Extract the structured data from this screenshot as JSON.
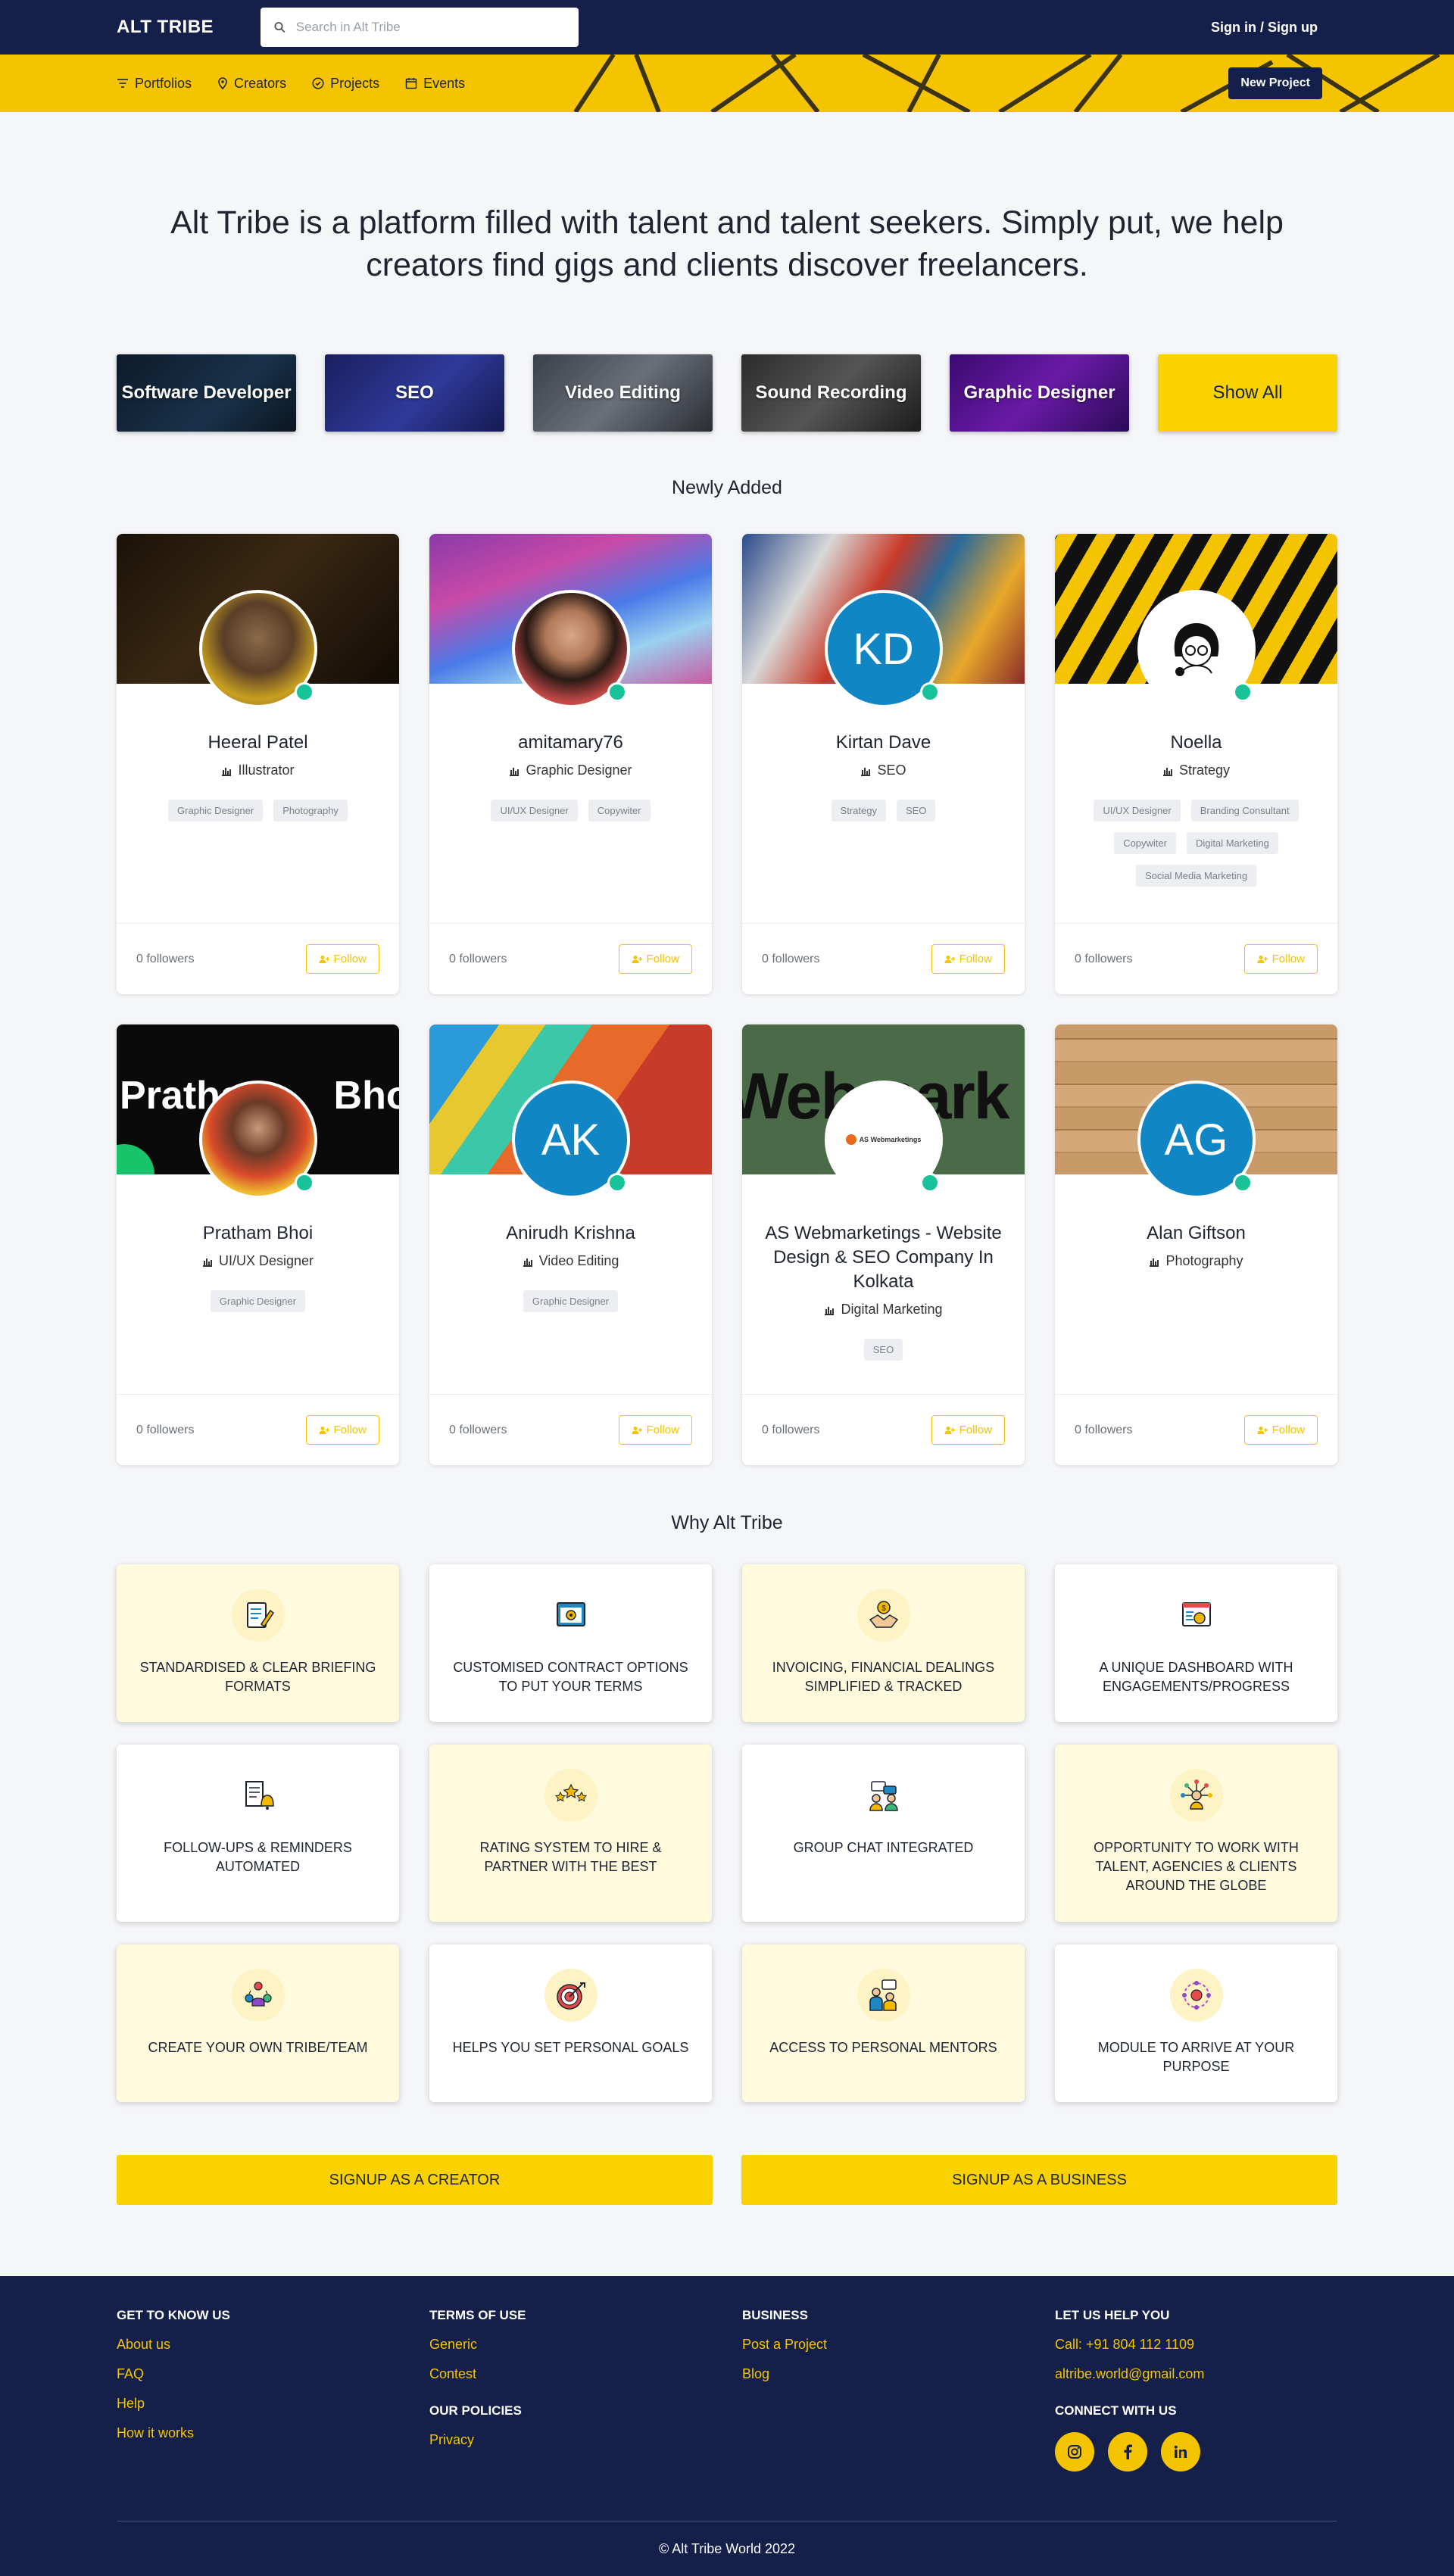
{
  "header": {
    "brand": "ALT TRIBE",
    "search_placeholder": "Search in Alt Tribe",
    "signin": "Sign in / Sign up"
  },
  "nav": {
    "items": [
      {
        "label": "Portfolios",
        "icon": "filter-icon"
      },
      {
        "label": "Creators",
        "icon": "location-pin-icon"
      },
      {
        "label": "Projects",
        "icon": "check-circle-icon"
      },
      {
        "label": "Events",
        "icon": "calendar-icon"
      }
    ],
    "new_project": "New Project"
  },
  "hero": {
    "text": "Alt Tribe is a platform filled with talent and talent seekers. Simply put, we help creators find gigs and clients discover freelancers."
  },
  "categories": [
    "Software Developer",
    "SEO",
    "Video Editing",
    "Sound Recording",
    "Graphic Designer",
    "Show All"
  ],
  "newly_added": {
    "title": "Newly Added",
    "cards": [
      {
        "name": "Heeral Patel",
        "role": "Illustrator",
        "tags": [
          "Graphic Designer",
          "Photography"
        ],
        "followers": "0 followers",
        "follow": "Follow",
        "initials": ""
      },
      {
        "name": "amitamary76",
        "role": "Graphic Designer",
        "tags": [
          "UI/UX Designer",
          "Copywiter"
        ],
        "followers": "0 followers",
        "follow": "Follow",
        "initials": ""
      },
      {
        "name": "Kirtan Dave",
        "role": "SEO",
        "tags": [
          "Strategy",
          "SEO"
        ],
        "followers": "0 followers",
        "follow": "Follow",
        "initials": "KD"
      },
      {
        "name": "Noella",
        "role": "Strategy",
        "tags": [
          "UI/UX Designer",
          "Branding Consultant",
          "Copywiter",
          "Digital Marketing",
          "Social Media Marketing"
        ],
        "followers": "0 followers",
        "follow": "Follow",
        "initials": ""
      },
      {
        "name": "Pratham Bhoi",
        "role": "UI/UX Designer",
        "tags": [
          "Graphic Designer"
        ],
        "followers": "0 followers",
        "follow": "Follow",
        "initials": "",
        "cover_text": "Pratham Bhoi"
      },
      {
        "name": "Anirudh Krishna",
        "role": "Video Editing",
        "tags": [
          "Graphic Designer"
        ],
        "followers": "0 followers",
        "follow": "Follow",
        "initials": "AK"
      },
      {
        "name": "AS Webmarketings - Website Design & SEO Company In Kolkata",
        "role": "Digital Marketing",
        "tags": [
          "SEO"
        ],
        "followers": "0 followers",
        "follow": "Follow",
        "initials": "",
        "cover_text": "Webmark",
        "logo_text": "AS Webmarketings"
      },
      {
        "name": "Alan Giftson",
        "role": "Photography",
        "tags": [],
        "followers": "0 followers",
        "follow": "Follow",
        "initials": "AG"
      }
    ]
  },
  "why": {
    "title": "Why Alt Tribe",
    "items": [
      {
        "text": "STANDARDISED & CLEAR BRIEFING FORMATS",
        "icon": "briefing-icon"
      },
      {
        "text": "CUSTOMISED CONTRACT OPTIONS TO PUT YOUR TERMS",
        "icon": "contract-icon"
      },
      {
        "text": "INVOICING, FINANCIAL DEALINGS SIMPLIFIED & TRACKED",
        "icon": "invoice-handshake-icon"
      },
      {
        "text": "A UNIQUE DASHBOARD WITH ENGAGEMENTS/PROGRESS",
        "icon": "dashboard-icon"
      },
      {
        "text": "FOLLOW-UPS & REMINDERS AUTOMATED",
        "icon": "reminder-bell-icon"
      },
      {
        "text": "RATING SYSTEM TO HIRE & PARTNER WITH THE BEST",
        "icon": "rating-stars-icon"
      },
      {
        "text": "GROUP CHAT INTEGRATED",
        "icon": "group-chat-icon"
      },
      {
        "text": "OPPORTUNITY TO WORK WITH TALENT, AGENCIES & CLIENTS AROUND THE GLOBE",
        "icon": "network-icon"
      },
      {
        "text": "CREATE YOUR OWN TRIBE/TEAM",
        "icon": "team-icon"
      },
      {
        "text": "HELPS YOU SET PERSONAL GOALS",
        "icon": "target-icon"
      },
      {
        "text": "ACCESS TO PERSONAL MENTORS",
        "icon": "mentor-icon"
      },
      {
        "text": "MODULE TO ARRIVE AT YOUR PURPOSE",
        "icon": "purpose-icon"
      }
    ]
  },
  "signup": {
    "creator": "SIGNUP AS A CREATOR",
    "business": "SIGNUP AS A BUSINESS"
  },
  "footer": {
    "col1": {
      "title": "GET TO KNOW US",
      "links": [
        "About us",
        "FAQ",
        "Help",
        "How it works"
      ]
    },
    "col2": {
      "title": "TERMS OF USE",
      "links": [
        "Generic",
        "Contest"
      ],
      "title2": "OUR POLICIES",
      "links2": [
        "Privacy"
      ]
    },
    "col3": {
      "title": "BUSINESS",
      "links": [
        "Post a Project",
        "Blog"
      ]
    },
    "col4": {
      "title": "LET US HELP YOU",
      "links": [
        "Call: +91 804 112 1109",
        "altribe.world@gmail.com"
      ],
      "title2": "CONNECT WITH US"
    },
    "socials": [
      "instagram-icon",
      "facebook-icon",
      "linkedin-icon"
    ],
    "copyright": "© Alt Tribe World 2022"
  },
  "colors": {
    "navy": "#14204a",
    "yellow": "#f5c400",
    "teal_status": "#19c39a",
    "avatar_blue": "#1186c4"
  }
}
